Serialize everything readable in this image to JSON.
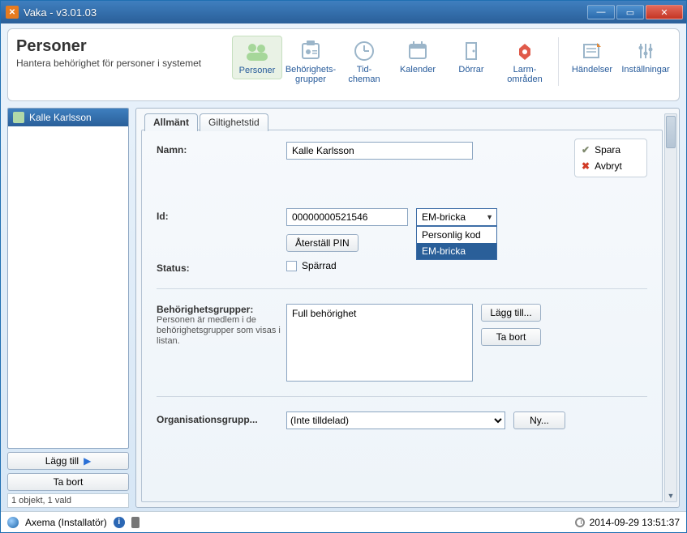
{
  "window": {
    "title": "Vaka - v3.01.03"
  },
  "ribbon": {
    "title": "Personer",
    "subtitle": "Hantera behörighet för personer i systemet",
    "items": [
      {
        "label": "Personer",
        "icon": "people-icon",
        "active": true
      },
      {
        "label": "Behörighets-\ngrupper",
        "icon": "badge-icon"
      },
      {
        "label": "Tid-\ncheman",
        "icon": "clock-icon"
      },
      {
        "label": "Kalender",
        "icon": "calendar-icon"
      },
      {
        "label": "Dörrar",
        "icon": "door-icon"
      },
      {
        "label": "Larm-\nområden",
        "icon": "alarm-icon"
      }
    ],
    "items_right": [
      {
        "label": "Händelser",
        "icon": "events-icon"
      },
      {
        "label": "Inställningar",
        "icon": "settings-icon"
      }
    ]
  },
  "sidebar": {
    "selected_person": "Kalle Karlsson",
    "add_label": "Lägg till",
    "remove_label": "Ta bort",
    "object_status": "1 objekt, 1 vald"
  },
  "tabs": {
    "general": "Allmänt",
    "validity": "Giltighetstid"
  },
  "form": {
    "name_label": "Namn:",
    "name_value": "Kalle Karlsson",
    "id_label": "Id:",
    "id_value": "00000000521546",
    "id_type_selected": "EM-bricka",
    "id_type_options": [
      "Personlig kod",
      "EM-bricka"
    ],
    "reset_pin": "Återställ PIN",
    "status_label": "Status:",
    "blocked_label": "Spärrad",
    "groups_label": "Behörighetsgrupper:",
    "groups_help": "Personen är medlem i de behörighetsgrupper som visas i listan.",
    "groups_value": "Full behörighet",
    "groups_add": "Lägg till...",
    "groups_remove": "Ta bort",
    "org_label": "Organisationsgrupp...",
    "org_value": "(Inte tilldelad)",
    "org_new": "Ny..."
  },
  "actions": {
    "save": "Spara",
    "cancel": "Avbryt"
  },
  "statusbar": {
    "user": "Axema (Installatör)",
    "datetime": "2014-09-29 13:51:37"
  },
  "colors": {
    "accent": "#2a5f99",
    "save_check": "#7f8a6e",
    "cancel_x": "#d13a26"
  }
}
